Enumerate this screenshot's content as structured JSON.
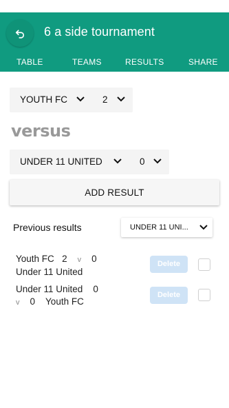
{
  "header": {
    "title": "6 a side tournament",
    "accent": "#109b80"
  },
  "tabs": [
    {
      "label": "TABLE"
    },
    {
      "label": "TEAMS"
    },
    {
      "label": "RESULTS"
    },
    {
      "label": "SHARE"
    }
  ],
  "form": {
    "home_team": "YOUTH FC",
    "home_score": "2",
    "versus": "versus",
    "away_team": "UNDER 11 UNITED",
    "away_score": "0",
    "add_label": "ADD RESULT"
  },
  "previous": {
    "label": "Previous results",
    "filter": "UNDER 11 UNI..."
  },
  "results": [
    {
      "line1_team": "Youth FC",
      "line1_score": "2",
      "v": "v",
      "line1_opp_score": "0",
      "line2": "Under 11 United",
      "delete_label": "Delete"
    },
    {
      "line1_team": "Under 11 United",
      "line1_score": "0",
      "v": "v",
      "line2_score": "0",
      "line2_team": "Youth FC",
      "delete_label": "Delete"
    }
  ]
}
